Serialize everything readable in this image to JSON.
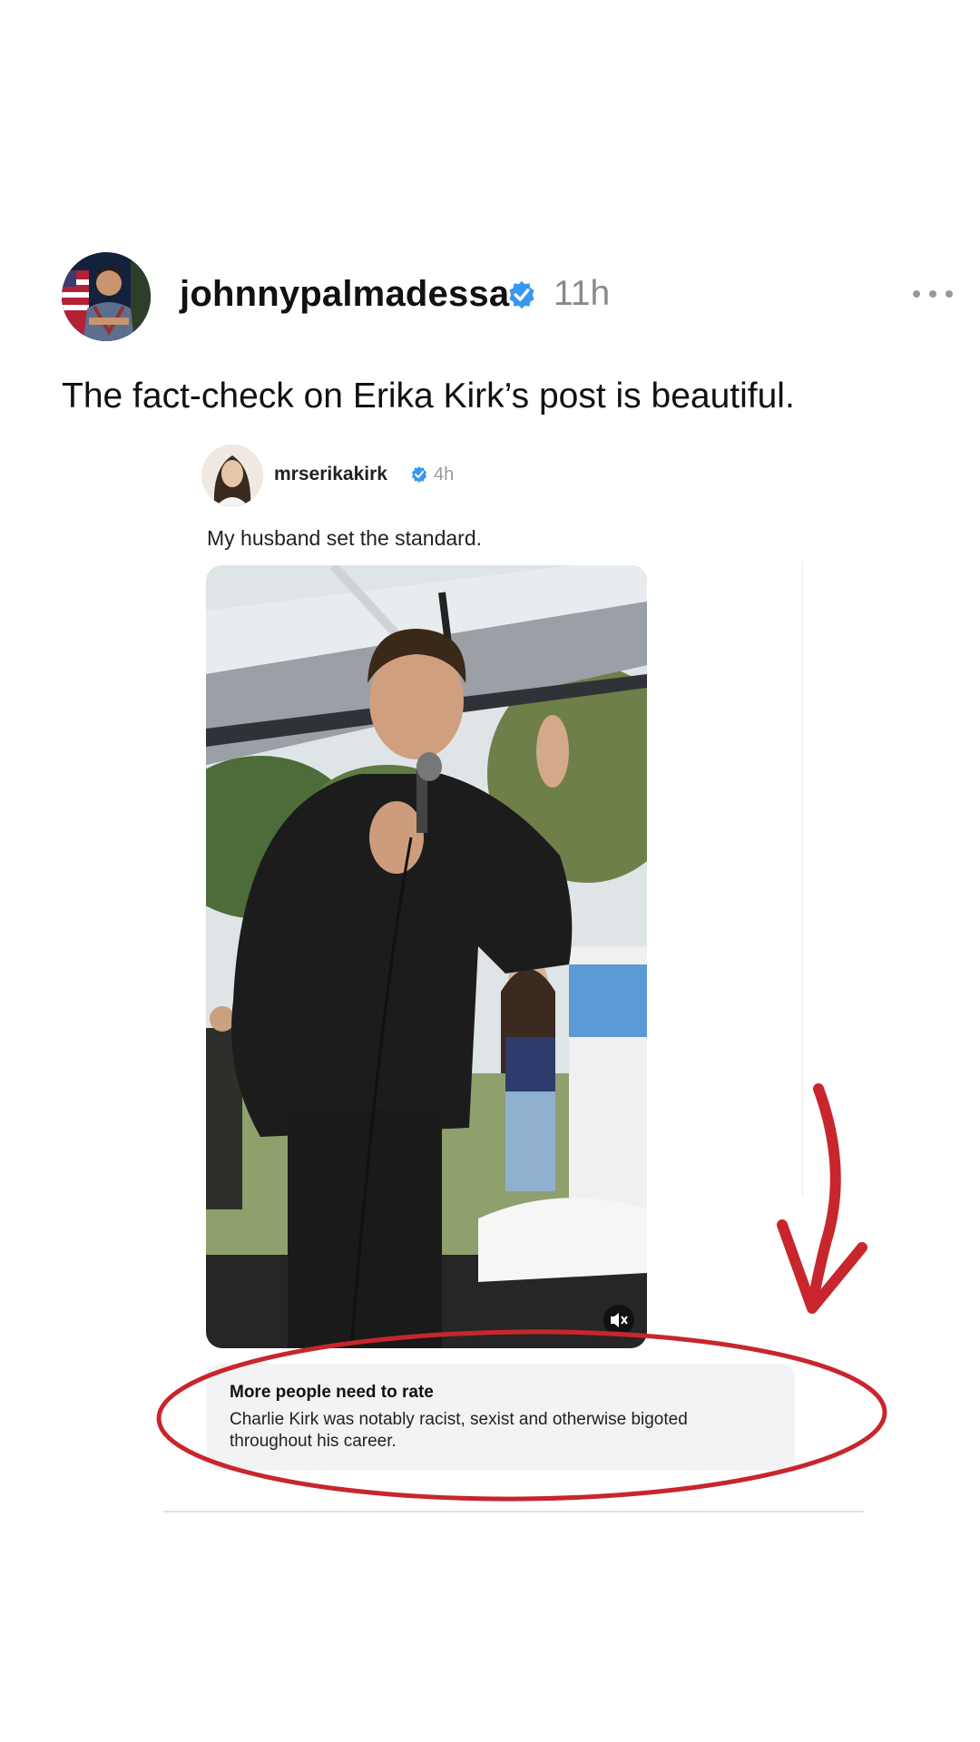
{
  "post": {
    "username": "johnnypalmadessa",
    "time": "11h",
    "caption": "The fact-check on Erika Kirk’s post is beautiful.",
    "more_icon": "more-horizontal-icon"
  },
  "embedded_post": {
    "username": "mrserikakirk",
    "time": "4h",
    "caption": "My husband set the standard.",
    "media_icon": "muted-speaker-icon"
  },
  "community_note": {
    "title": "More people need to rate",
    "text": "Charlie Kirk was notably racist, sexist and otherwise bigoted throughout his career."
  },
  "colors": {
    "verified": "#3897f0",
    "annotation": "#c8262c",
    "note_bg": "#f2f3f5"
  }
}
